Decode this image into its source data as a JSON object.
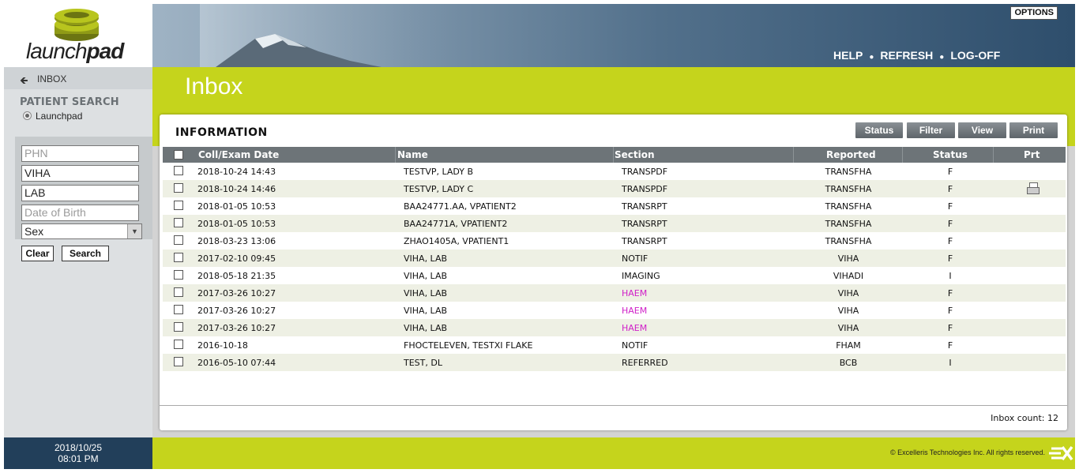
{
  "logo": {
    "text_light": "launch",
    "text_bold": "pad"
  },
  "nav": {
    "back_label": "INBOX"
  },
  "patient_search": {
    "heading": "PATIENT SEARCH",
    "radio_label": "Launchpad",
    "phn_placeholder": "PHN",
    "field_viha": "VIHA",
    "field_lab": "LAB",
    "dob_placeholder": "Date of Birth",
    "sex_value": "Sex",
    "clear_label": "Clear",
    "search_label": "Search"
  },
  "clock": {
    "date": "2018/10/25",
    "time": "08:01 PM"
  },
  "header": {
    "options_label": "OPTIONS",
    "help_label": "HELP",
    "refresh_label": "REFRESH",
    "logoff_label": "LOG-OFF",
    "separator": "●"
  },
  "page_title": "Inbox",
  "panel": {
    "title": "INFORMATION",
    "buttons": {
      "status": "Status",
      "filter": "Filter",
      "view": "View",
      "print": "Print"
    }
  },
  "table": {
    "columns": {
      "date": "Coll/Exam Date",
      "name": "Name",
      "section": "Section",
      "reported": "Reported",
      "status": "Status",
      "prt": "Prt"
    },
    "rows": [
      {
        "date": "2018-10-24 14:43",
        "name": "TESTVP, LADY B",
        "section": "TRANSPDF",
        "reported": "TRANSFHA",
        "status": "F",
        "printed": false
      },
      {
        "date": "2018-10-24 14:46",
        "name": "TESTVP, LADY C",
        "section": "TRANSPDF",
        "reported": "TRANSFHA",
        "status": "F",
        "printed": true
      },
      {
        "date": "2018-01-05 10:53",
        "name": "BAA24771.AA, VPATIENT2",
        "section": "TRANSRPT",
        "reported": "TRANSFHA",
        "status": "F",
        "printed": false
      },
      {
        "date": "2018-01-05 10:53",
        "name": "BAA24771A, VPATIENT2",
        "section": "TRANSRPT",
        "reported": "TRANSFHA",
        "status": "F",
        "printed": false
      },
      {
        "date": "2018-03-23 13:06",
        "name": "ZHAO1405A, VPATIENT1",
        "section": "TRANSRPT",
        "reported": "TRANSFHA",
        "status": "F",
        "printed": false
      },
      {
        "date": "2017-02-10 09:45",
        "name": "VIHA, LAB",
        "section": "NOTIF",
        "reported": "VIHA",
        "status": "F",
        "printed": false
      },
      {
        "date": "2018-05-18 21:35",
        "name": "VIHA, LAB",
        "section": "IMAGING",
        "reported": "VIHADI",
        "status": "I",
        "printed": false
      },
      {
        "date": "2017-03-26 10:27",
        "name": "VIHA, LAB",
        "section": "HAEM",
        "reported": "VIHA",
        "status": "F",
        "printed": false,
        "section_color": "#d020c8"
      },
      {
        "date": "2017-03-26 10:27",
        "name": "VIHA, LAB",
        "section": "HAEM",
        "reported": "VIHA",
        "status": "F",
        "printed": false,
        "section_color": "#d020c8"
      },
      {
        "date": "2017-03-26 10:27",
        "name": "VIHA, LAB",
        "section": "HAEM",
        "reported": "VIHA",
        "status": "F",
        "printed": false,
        "section_color": "#d020c8"
      },
      {
        "date": "2016-10-18",
        "name": "FHOCTELEVEN, TESTXI FLAKE",
        "section": "NOTIF",
        "reported": "FHAM",
        "status": "F",
        "printed": false
      },
      {
        "date": "2016-05-10 07:44",
        "name": "TEST, DL",
        "section": "REFERRED",
        "reported": "BCB",
        "status": "I",
        "printed": false
      }
    ]
  },
  "inbox_count": "Inbox count: 12",
  "footer": {
    "copyright": "© Excelleris Technologies Inc. All rights reserved."
  },
  "colors": {
    "accent_green": "#c5d41c",
    "nav_blue": "#223f5a",
    "haem_magenta": "#d020c8"
  }
}
